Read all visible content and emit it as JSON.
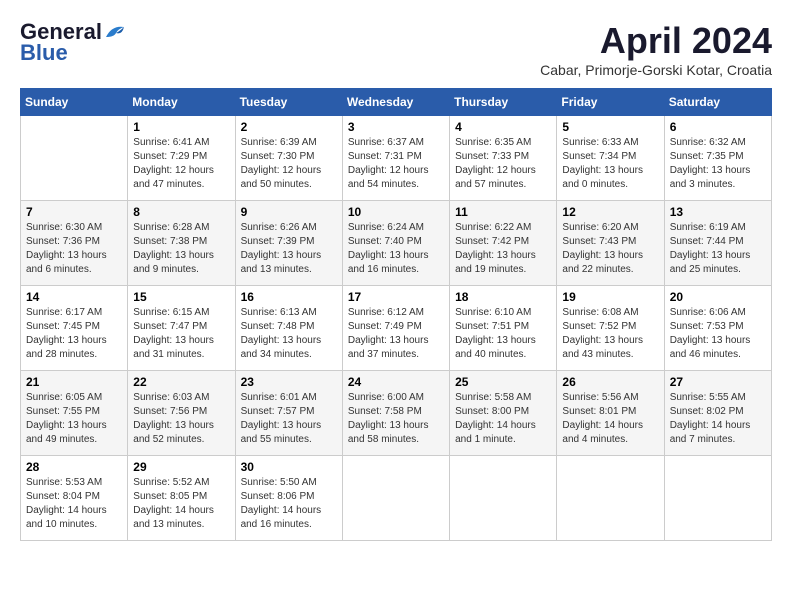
{
  "header": {
    "logo_general": "General",
    "logo_blue": "Blue",
    "month_title": "April 2024",
    "location": "Cabar, Primorje-Gorski Kotar, Croatia"
  },
  "weekdays": [
    "Sunday",
    "Monday",
    "Tuesday",
    "Wednesday",
    "Thursday",
    "Friday",
    "Saturday"
  ],
  "weeks": [
    [
      {
        "day": "",
        "sunrise": "",
        "sunset": "",
        "daylight": ""
      },
      {
        "day": "1",
        "sunrise": "Sunrise: 6:41 AM",
        "sunset": "Sunset: 7:29 PM",
        "daylight": "Daylight: 12 hours and 47 minutes."
      },
      {
        "day": "2",
        "sunrise": "Sunrise: 6:39 AM",
        "sunset": "Sunset: 7:30 PM",
        "daylight": "Daylight: 12 hours and 50 minutes."
      },
      {
        "day": "3",
        "sunrise": "Sunrise: 6:37 AM",
        "sunset": "Sunset: 7:31 PM",
        "daylight": "Daylight: 12 hours and 54 minutes."
      },
      {
        "day": "4",
        "sunrise": "Sunrise: 6:35 AM",
        "sunset": "Sunset: 7:33 PM",
        "daylight": "Daylight: 12 hours and 57 minutes."
      },
      {
        "day": "5",
        "sunrise": "Sunrise: 6:33 AM",
        "sunset": "Sunset: 7:34 PM",
        "daylight": "Daylight: 13 hours and 0 minutes."
      },
      {
        "day": "6",
        "sunrise": "Sunrise: 6:32 AM",
        "sunset": "Sunset: 7:35 PM",
        "daylight": "Daylight: 13 hours and 3 minutes."
      }
    ],
    [
      {
        "day": "7",
        "sunrise": "Sunrise: 6:30 AM",
        "sunset": "Sunset: 7:36 PM",
        "daylight": "Daylight: 13 hours and 6 minutes."
      },
      {
        "day": "8",
        "sunrise": "Sunrise: 6:28 AM",
        "sunset": "Sunset: 7:38 PM",
        "daylight": "Daylight: 13 hours and 9 minutes."
      },
      {
        "day": "9",
        "sunrise": "Sunrise: 6:26 AM",
        "sunset": "Sunset: 7:39 PM",
        "daylight": "Daylight: 13 hours and 13 minutes."
      },
      {
        "day": "10",
        "sunrise": "Sunrise: 6:24 AM",
        "sunset": "Sunset: 7:40 PM",
        "daylight": "Daylight: 13 hours and 16 minutes."
      },
      {
        "day": "11",
        "sunrise": "Sunrise: 6:22 AM",
        "sunset": "Sunset: 7:42 PM",
        "daylight": "Daylight: 13 hours and 19 minutes."
      },
      {
        "day": "12",
        "sunrise": "Sunrise: 6:20 AM",
        "sunset": "Sunset: 7:43 PM",
        "daylight": "Daylight: 13 hours and 22 minutes."
      },
      {
        "day": "13",
        "sunrise": "Sunrise: 6:19 AM",
        "sunset": "Sunset: 7:44 PM",
        "daylight": "Daylight: 13 hours and 25 minutes."
      }
    ],
    [
      {
        "day": "14",
        "sunrise": "Sunrise: 6:17 AM",
        "sunset": "Sunset: 7:45 PM",
        "daylight": "Daylight: 13 hours and 28 minutes."
      },
      {
        "day": "15",
        "sunrise": "Sunrise: 6:15 AM",
        "sunset": "Sunset: 7:47 PM",
        "daylight": "Daylight: 13 hours and 31 minutes."
      },
      {
        "day": "16",
        "sunrise": "Sunrise: 6:13 AM",
        "sunset": "Sunset: 7:48 PM",
        "daylight": "Daylight: 13 hours and 34 minutes."
      },
      {
        "day": "17",
        "sunrise": "Sunrise: 6:12 AM",
        "sunset": "Sunset: 7:49 PM",
        "daylight": "Daylight: 13 hours and 37 minutes."
      },
      {
        "day": "18",
        "sunrise": "Sunrise: 6:10 AM",
        "sunset": "Sunset: 7:51 PM",
        "daylight": "Daylight: 13 hours and 40 minutes."
      },
      {
        "day": "19",
        "sunrise": "Sunrise: 6:08 AM",
        "sunset": "Sunset: 7:52 PM",
        "daylight": "Daylight: 13 hours and 43 minutes."
      },
      {
        "day": "20",
        "sunrise": "Sunrise: 6:06 AM",
        "sunset": "Sunset: 7:53 PM",
        "daylight": "Daylight: 13 hours and 46 minutes."
      }
    ],
    [
      {
        "day": "21",
        "sunrise": "Sunrise: 6:05 AM",
        "sunset": "Sunset: 7:55 PM",
        "daylight": "Daylight: 13 hours and 49 minutes."
      },
      {
        "day": "22",
        "sunrise": "Sunrise: 6:03 AM",
        "sunset": "Sunset: 7:56 PM",
        "daylight": "Daylight: 13 hours and 52 minutes."
      },
      {
        "day": "23",
        "sunrise": "Sunrise: 6:01 AM",
        "sunset": "Sunset: 7:57 PM",
        "daylight": "Daylight: 13 hours and 55 minutes."
      },
      {
        "day": "24",
        "sunrise": "Sunrise: 6:00 AM",
        "sunset": "Sunset: 7:58 PM",
        "daylight": "Daylight: 13 hours and 58 minutes."
      },
      {
        "day": "25",
        "sunrise": "Sunrise: 5:58 AM",
        "sunset": "Sunset: 8:00 PM",
        "daylight": "Daylight: 14 hours and 1 minute."
      },
      {
        "day": "26",
        "sunrise": "Sunrise: 5:56 AM",
        "sunset": "Sunset: 8:01 PM",
        "daylight": "Daylight: 14 hours and 4 minutes."
      },
      {
        "day": "27",
        "sunrise": "Sunrise: 5:55 AM",
        "sunset": "Sunset: 8:02 PM",
        "daylight": "Daylight: 14 hours and 7 minutes."
      }
    ],
    [
      {
        "day": "28",
        "sunrise": "Sunrise: 5:53 AM",
        "sunset": "Sunset: 8:04 PM",
        "daylight": "Daylight: 14 hours and 10 minutes."
      },
      {
        "day": "29",
        "sunrise": "Sunrise: 5:52 AM",
        "sunset": "Sunset: 8:05 PM",
        "daylight": "Daylight: 14 hours and 13 minutes."
      },
      {
        "day": "30",
        "sunrise": "Sunrise: 5:50 AM",
        "sunset": "Sunset: 8:06 PM",
        "daylight": "Daylight: 14 hours and 16 minutes."
      },
      {
        "day": "",
        "sunrise": "",
        "sunset": "",
        "daylight": ""
      },
      {
        "day": "",
        "sunrise": "",
        "sunset": "",
        "daylight": ""
      },
      {
        "day": "",
        "sunrise": "",
        "sunset": "",
        "daylight": ""
      },
      {
        "day": "",
        "sunrise": "",
        "sunset": "",
        "daylight": ""
      }
    ]
  ]
}
